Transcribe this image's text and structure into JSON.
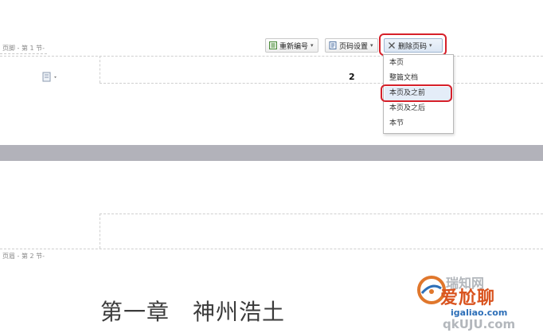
{
  "sections": {
    "footer_label": "页脚 - 第 1 节-",
    "header_label": "页眉 - 第 2 节-"
  },
  "toolbar": {
    "renumber_label": "重新编号",
    "page_settings_label": "页码设置",
    "delete_page_number_label": "删除页码"
  },
  "dropdown": {
    "items": [
      {
        "label": "本页"
      },
      {
        "label": "整篇文档"
      },
      {
        "label": "本页及之前"
      },
      {
        "label": "本页及之后"
      },
      {
        "label": "本节"
      }
    ]
  },
  "page_number": "2",
  "chapter_title": "第一章　神州浩土",
  "watermark": {
    "top_text": "瑞知网",
    "brand_text": "爱尬聊",
    "url_text": "igaliao.com",
    "bottom_text": "qkUJU.com"
  },
  "colors": {
    "highlight_ring": "#d6202a",
    "page_gap": "#b2b2ba",
    "menu_highlight": "#e4edf8"
  },
  "icons": {
    "renumber": "renumber-icon",
    "page_settings": "page-settings-icon",
    "delete": "close-x-icon",
    "doc": "document-icon"
  }
}
